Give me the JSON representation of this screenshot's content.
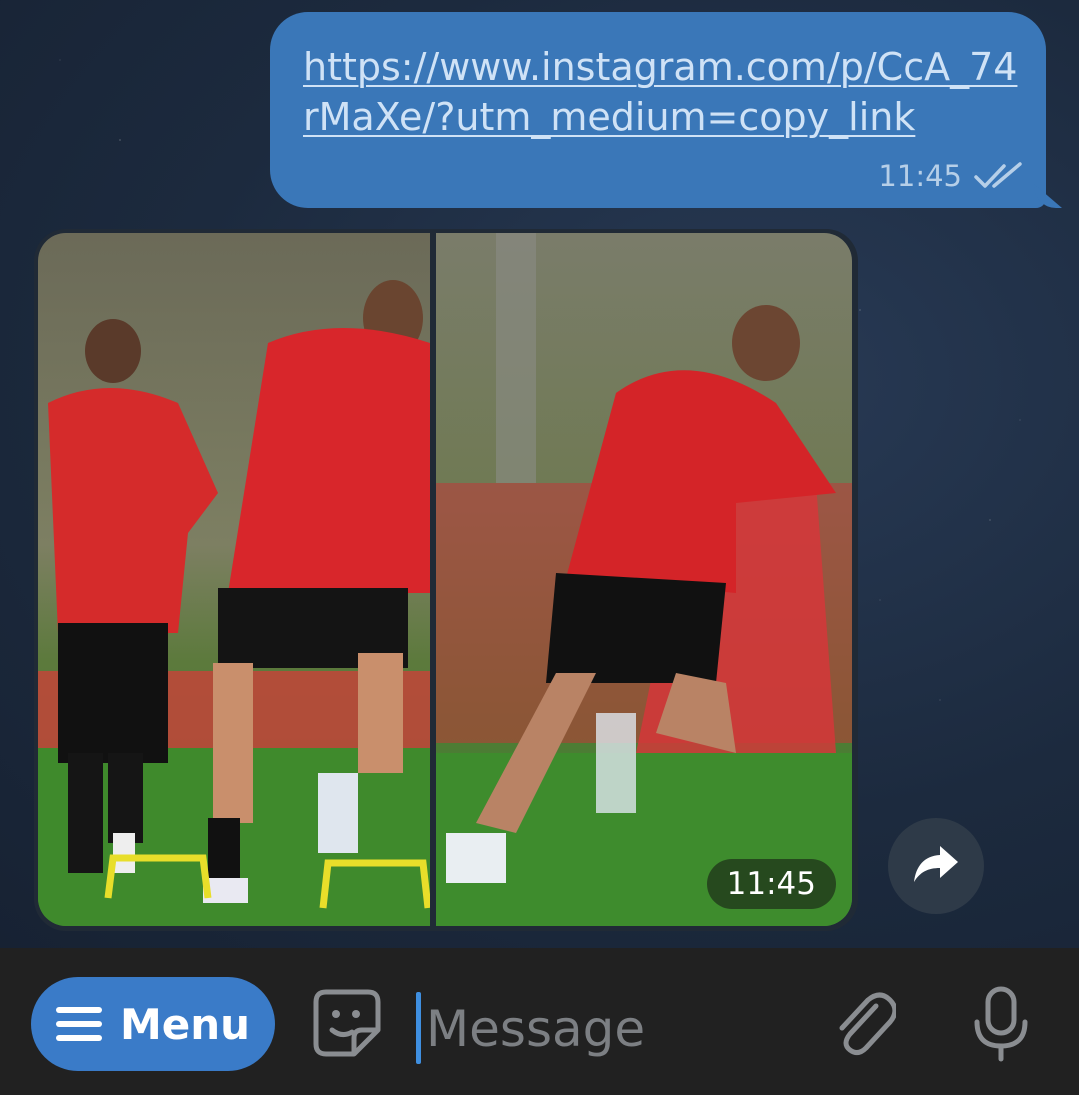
{
  "chat": {
    "outgoing_message": {
      "link": "https://www.instagram.com/p/CcA_74rMaXe/?utm_medium=copy_link",
      "time": "11:45",
      "status_icon": "double-check-icon"
    },
    "media_album": {
      "photo_count": 2,
      "time": "11:45"
    },
    "share_icon": "share-arrow-icon"
  },
  "input_bar": {
    "menu_label": "Menu",
    "menu_icon": "hamburger-icon",
    "sticker_icon": "sticker-icon",
    "message_placeholder": "Message",
    "message_value": "",
    "attach_icon": "paperclip-icon",
    "mic_icon": "microphone-icon"
  },
  "colors": {
    "outgoing_bubble": "#3a77b8",
    "link_text": "#cfe2f6",
    "menu_button": "#3a7bc8",
    "input_bar": "#212121",
    "cursor": "#3f8fe0"
  }
}
